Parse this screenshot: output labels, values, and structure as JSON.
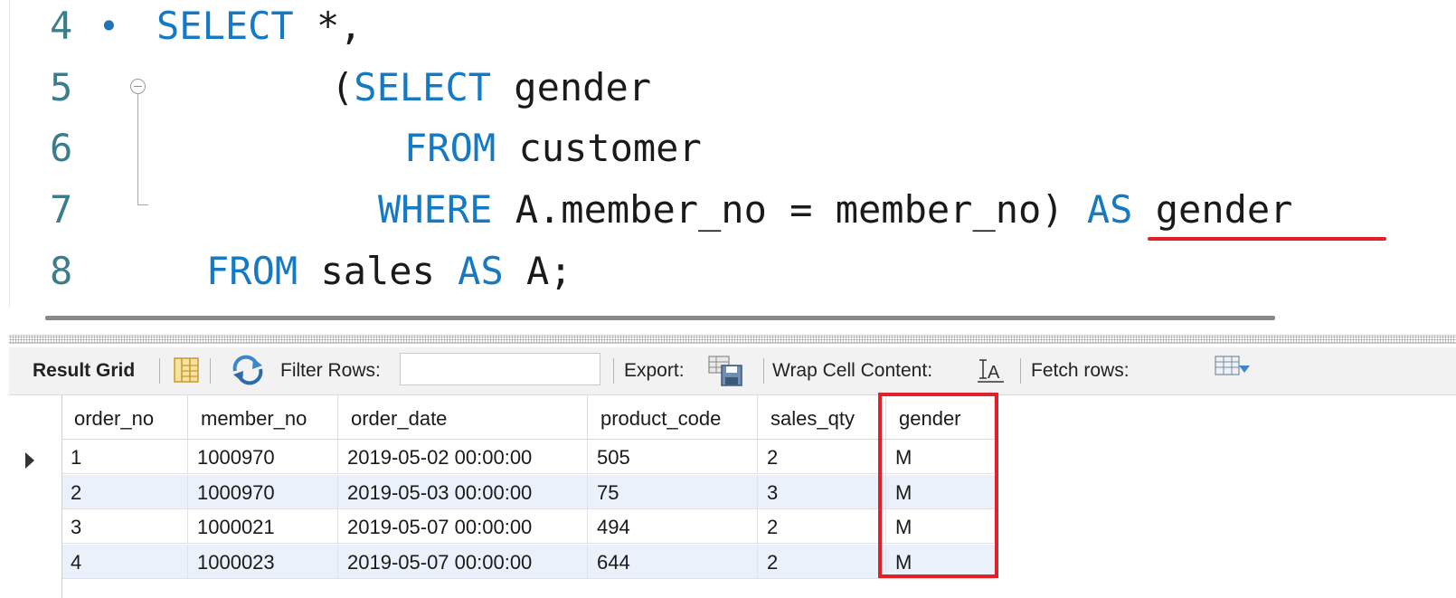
{
  "editor": {
    "lines": [
      {
        "num": "4",
        "dot": "•",
        "parts": [
          {
            "t": "SELECT",
            "kw": true
          },
          {
            "t": " *,",
            "kw": false
          }
        ]
      },
      {
        "num": "5",
        "dot": "",
        "parts": [
          {
            "t": "(",
            "kw": false
          },
          {
            "t": "SELECT",
            "kw": true
          },
          {
            "t": " gender",
            "kw": false
          }
        ]
      },
      {
        "num": "6",
        "dot": "",
        "parts": [
          {
            "t": "FROM",
            "kw": true
          },
          {
            "t": " customer",
            "kw": false
          }
        ]
      },
      {
        "num": "7",
        "dot": "",
        "parts": [
          {
            "t": "WHERE",
            "kw": true
          },
          {
            "t": " A.member_no = member_no) ",
            "kw": false
          },
          {
            "t": "AS",
            "kw": true
          },
          {
            "t": " gender",
            "kw": false
          }
        ]
      },
      {
        "num": "8",
        "dot": "",
        "parts": [
          {
            "t": "FROM",
            "kw": true
          },
          {
            "t": " sales ",
            "kw": false
          },
          {
            "t": "AS",
            "kw": true
          },
          {
            "t": " A;",
            "kw": false
          }
        ]
      }
    ]
  },
  "toolbar": {
    "result_grid": "Result Grid",
    "filter_rows": "Filter Rows:",
    "export": "Export:",
    "wrap_cell": "Wrap Cell Content:",
    "fetch_rows": "Fetch rows:",
    "icons": [
      "grid-layout-icon",
      "refresh-icon",
      "export-icon",
      "wrap-text-icon",
      "fetch-rows-icon"
    ]
  },
  "grid": {
    "columns": [
      "order_no",
      "member_no",
      "order_date",
      "product_code",
      "sales_qty",
      "gender"
    ],
    "rows": [
      [
        "1",
        "1000970",
        "2019-05-02 00:00:00",
        "505",
        "2",
        "M"
      ],
      [
        "2",
        "1000970",
        "2019-05-03 00:00:00",
        "75",
        "3",
        "M"
      ],
      [
        "3",
        "1000021",
        "2019-05-07 00:00:00",
        "494",
        "2",
        "M"
      ],
      [
        "4",
        "1000023",
        "2019-05-07 00:00:00",
        "644",
        "2",
        "M"
      ]
    ]
  },
  "colors": {
    "keyword": "#1579c4",
    "line_number": "#3a7d8c",
    "highlight": "#e0202a",
    "alt_row": "#eaf1fb"
  }
}
